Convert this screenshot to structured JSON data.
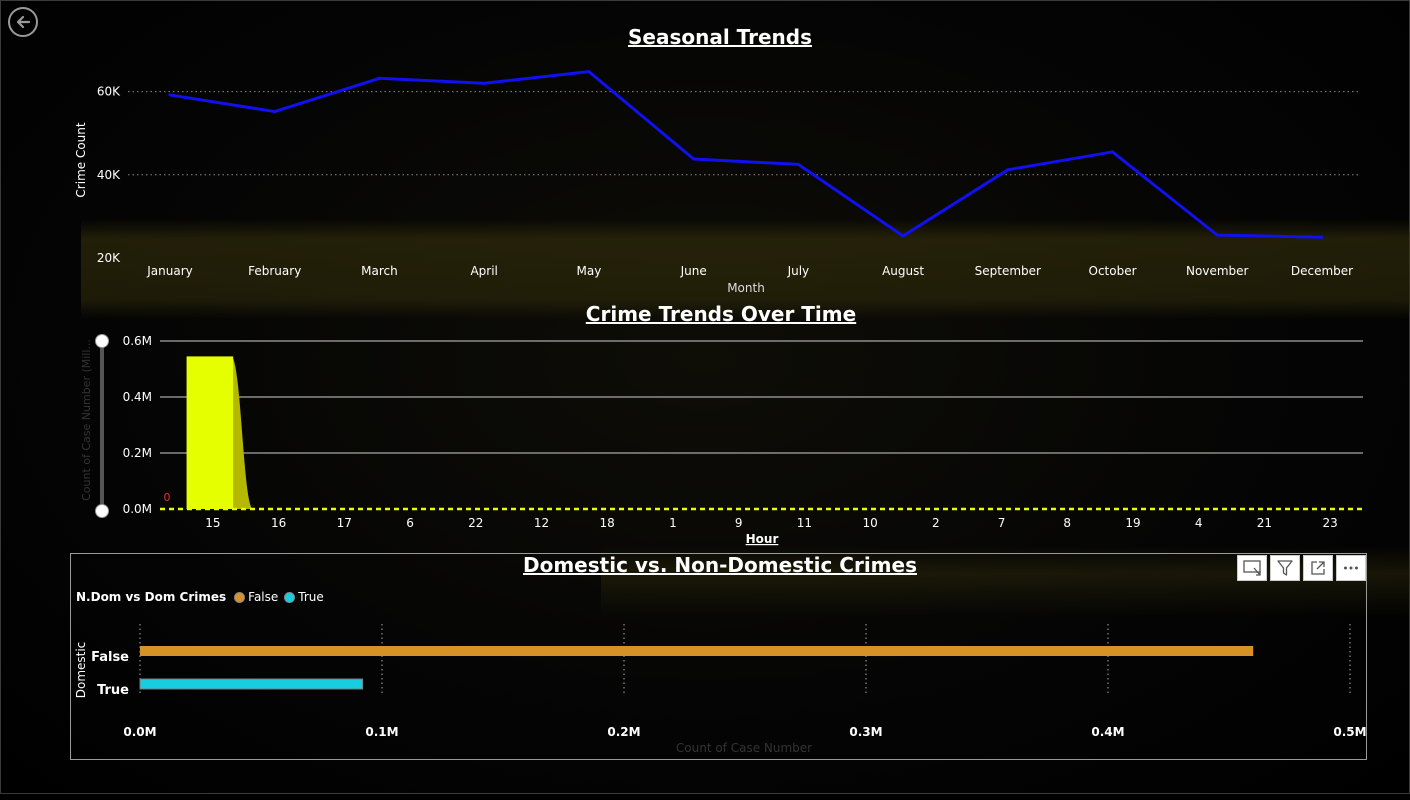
{
  "colors": {
    "seasonal_line": "#1010f0",
    "area_fill": "#e6ff00",
    "area_dark": "#b4b800",
    "bar_false": "#d69226",
    "bar_true": "#17cde0"
  },
  "icons": {
    "back": "back-arrow-icon",
    "focus": "focus-mode-icon",
    "filter": "filter-icon",
    "expand": "expand-icon",
    "more": "more-options-icon"
  },
  "chart_data": [
    {
      "type": "line",
      "title": "Seasonal Trends",
      "xlabel": "Month",
      "ylabel": "Crime Count",
      "categories": [
        "January",
        "February",
        "March",
        "April",
        "May",
        "June",
        "July",
        "August",
        "September",
        "October",
        "November",
        "December"
      ],
      "values": [
        59200,
        55200,
        63200,
        62000,
        64800,
        43800,
        42500,
        25300,
        41200,
        45500,
        25500,
        25000
      ],
      "ylim": [
        20000,
        70000
      ],
      "yticks": [
        20000,
        40000,
        60000
      ],
      "ytick_labels": [
        "20K",
        "40K",
        "60K"
      ],
      "grid": true
    },
    {
      "type": "area",
      "title": "Crime Trends Over Time",
      "xlabel": "Hour",
      "ylabel": "Count of Case Number (Mill...",
      "categories": [
        "15",
        "16",
        "17",
        "6",
        "22",
        "12",
        "18",
        "1",
        "9",
        "11",
        "10",
        "2",
        "7",
        "8",
        "19",
        "4",
        "21",
        "23"
      ],
      "values": [
        545000,
        0,
        0,
        0,
        0,
        0,
        0,
        0,
        0,
        0,
        0,
        0,
        0,
        0,
        0,
        0,
        0,
        0
      ],
      "ylim": [
        0,
        600000
      ],
      "yticks": [
        0,
        200000,
        400000,
        600000
      ],
      "ytick_labels": [
        "0.0M",
        "0.2M",
        "0.4M",
        "0.6M"
      ],
      "annotation": "0",
      "grid": true
    },
    {
      "type": "bar",
      "orientation": "horizontal",
      "title": "Domestic vs. Non-Domestic Crimes",
      "xlabel": "Count of Case Number",
      "ylabel": "Domestic",
      "legend_title": "N.Dom vs Dom Crimes",
      "categories": [
        "False",
        "True"
      ],
      "values": [
        460000,
        92000
      ],
      "series": [
        {
          "name": "False",
          "values": [
            460000,
            0
          ]
        },
        {
          "name": "True",
          "values": [
            0,
            92000
          ]
        }
      ],
      "xlim": [
        0,
        500000
      ],
      "xticks": [
        0,
        100000,
        200000,
        300000,
        400000,
        500000
      ],
      "xtick_labels": [
        "0.0M",
        "0.1M",
        "0.2M",
        "0.3M",
        "0.4M",
        "0.5M"
      ],
      "grid": true,
      "legend_position": "top-left"
    }
  ]
}
